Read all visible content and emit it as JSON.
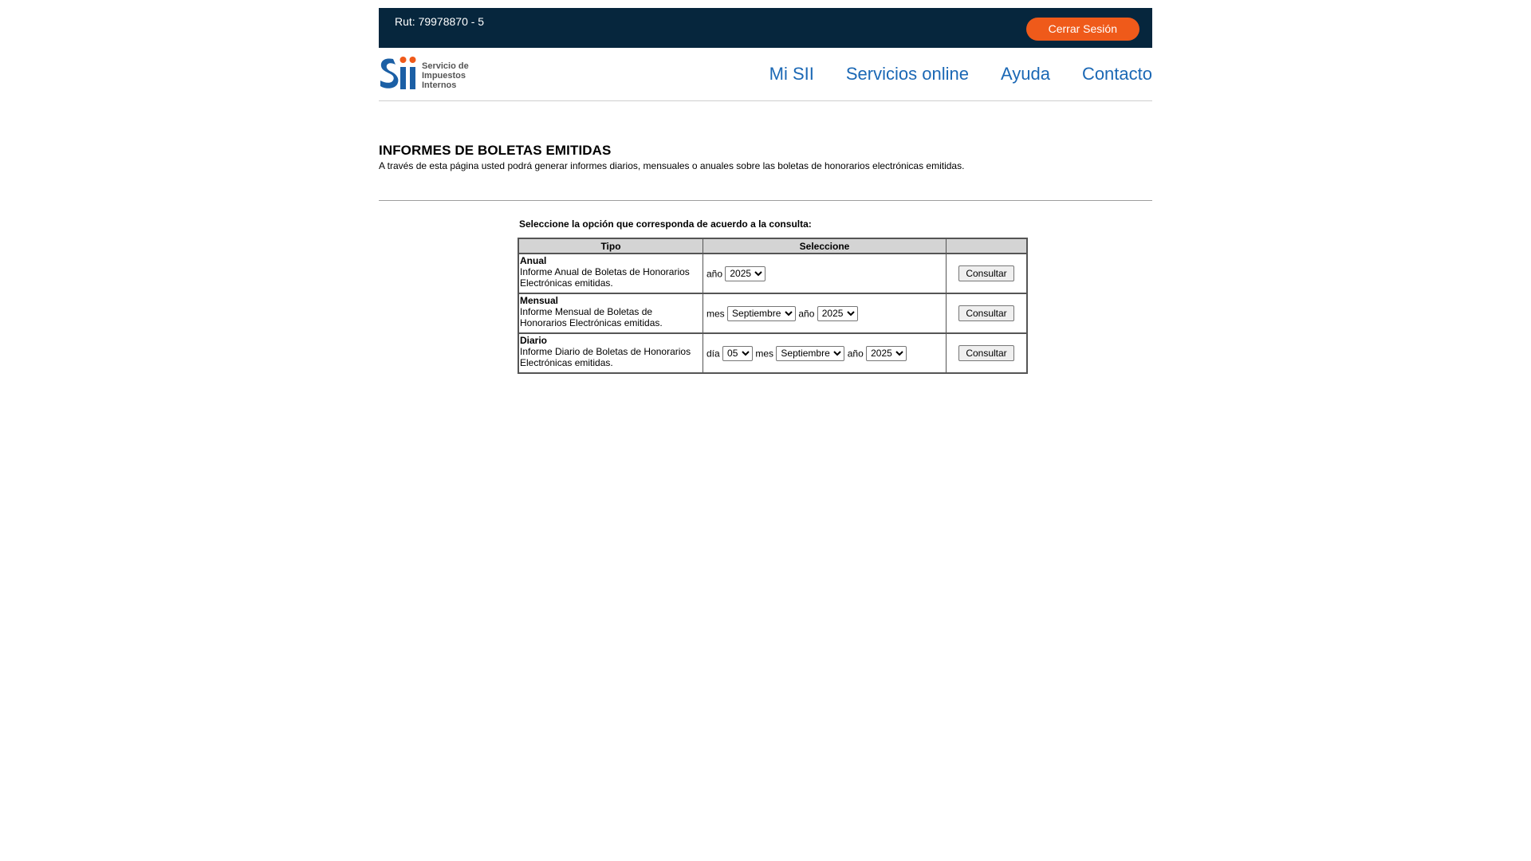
{
  "topbar": {
    "rut": "Rut: 79978870 - 5",
    "logout_label": "Cerrar Sesión"
  },
  "header": {
    "logo_lines": [
      "Servicio de",
      "Impuestos",
      "Internos"
    ],
    "nav": [
      {
        "label": "Mi SII"
      },
      {
        "label": "Servicios online"
      },
      {
        "label": "Ayuda"
      },
      {
        "label": "Contacto"
      }
    ]
  },
  "page": {
    "title": "INFORMES DE BOLETAS EMITIDAS",
    "subtitle": "A través de esta página usted podrá generar informes diarios, mensuales o anuales sobre las boletas de honorarios electrónicas emitidas.",
    "instruction": "Seleccione la opción que corresponda de acuerdo a la consulta:"
  },
  "table": {
    "headers": [
      "Tipo",
      "Seleccione",
      ""
    ],
    "rows": [
      {
        "name": "Anual",
        "description": "Informe Anual de Boletas de Honorarios Electrónicas emitidas.",
        "year_label": "año",
        "year": "2025",
        "button": "Consultar"
      },
      {
        "name": "Mensual",
        "description": "Informe Mensual de Boletas de Honorarios Electrónicas emitidas.",
        "month_label": "mes",
        "month": "Septiembre",
        "year_label": "año",
        "year": "2025",
        "button": "Consultar"
      },
      {
        "name": "Diario",
        "description": "Informe Diario de Boletas de Honorarios Electrónicas emitidas.",
        "day_label": "día",
        "day": "05",
        "month_label": "mes",
        "month": "Septiembre",
        "year_label": "año",
        "year": "2025",
        "button": "Consultar"
      }
    ]
  },
  "colors": {
    "topbar_bg": "#06263d",
    "logout_bg": "#ef5a1a",
    "nav_link": "#1b68b5",
    "logo_blue": "#1b5fa5",
    "logo_dots": "#ef5a1a"
  }
}
